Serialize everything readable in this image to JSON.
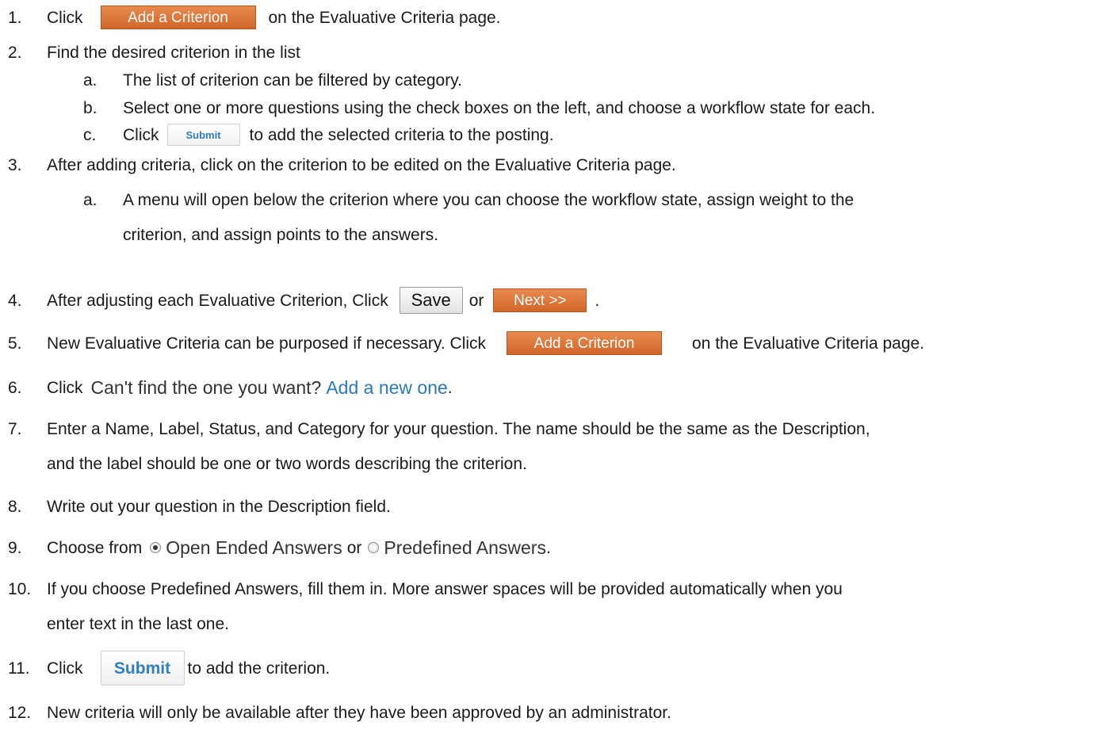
{
  "steps": [
    {
      "num": "1.",
      "pre": "Click",
      "button": "Add a Criterion",
      "post": "on the Evaluative Criteria page."
    },
    {
      "num": "2.",
      "text": "Find the desired criterion in the list"
    },
    {
      "num": "a.",
      "text": "The list of criterion can be filtered by category."
    },
    {
      "num": "b.",
      "text": "Select one or more questions using the check boxes on the left, and choose a workflow state for each."
    },
    {
      "num": "c.",
      "pre": "Click",
      "button": "Submit",
      "post": "to add the selected criteria to the posting."
    },
    {
      "num": "3.",
      "text": "After adding criteria, click on the criterion to be edited on the Evaluative Criteria page."
    },
    {
      "num": "a.",
      "text": "A menu will open below the criterion where you can choose the workflow state, assign weight to the"
    },
    {
      "text": "criterion, and assign points to the answers."
    },
    {
      "num": "4.",
      "pre": "After adjusting each Evaluative Criterion, Click",
      "button": "Save",
      "mid": "or",
      "button2": "Next >>",
      "post": "."
    },
    {
      "num": "5.",
      "pre": "New Evaluative Criteria can be purposed if necessary.  Click",
      "button": "Add a Criterion",
      "post": "on the Evaluative Criteria page."
    },
    {
      "num": "6.",
      "pre": "Click",
      "ui_text": "Can't find the one you want?",
      "ui_link": "Add a new one",
      "post": "."
    },
    {
      "num": "7.",
      "text": "Enter a Name, Label, Status, and Category for your question. The name should be the same as the Description,"
    },
    {
      "text": "and the label should be one or two words describing the criterion."
    },
    {
      "num": "8.",
      "text": "Write out your question in the Description field."
    },
    {
      "num": "9.",
      "pre": "Choose from",
      "radio1": "Open Ended Answers",
      "mid": "or",
      "radio2": "Predefined Answers",
      "post": "."
    },
    {
      "num": "10.",
      "text": "If you choose Predefined Answers, fill them in. More answer spaces will be provided automatically when you"
    },
    {
      "text": "enter text in the last one."
    },
    {
      "num": "11.",
      "pre": "Click",
      "button": "Submit",
      "post": "to add the criterion."
    },
    {
      "num": "12.",
      "text": "New criteria will only be available after they have been approved by an administrator."
    }
  ]
}
